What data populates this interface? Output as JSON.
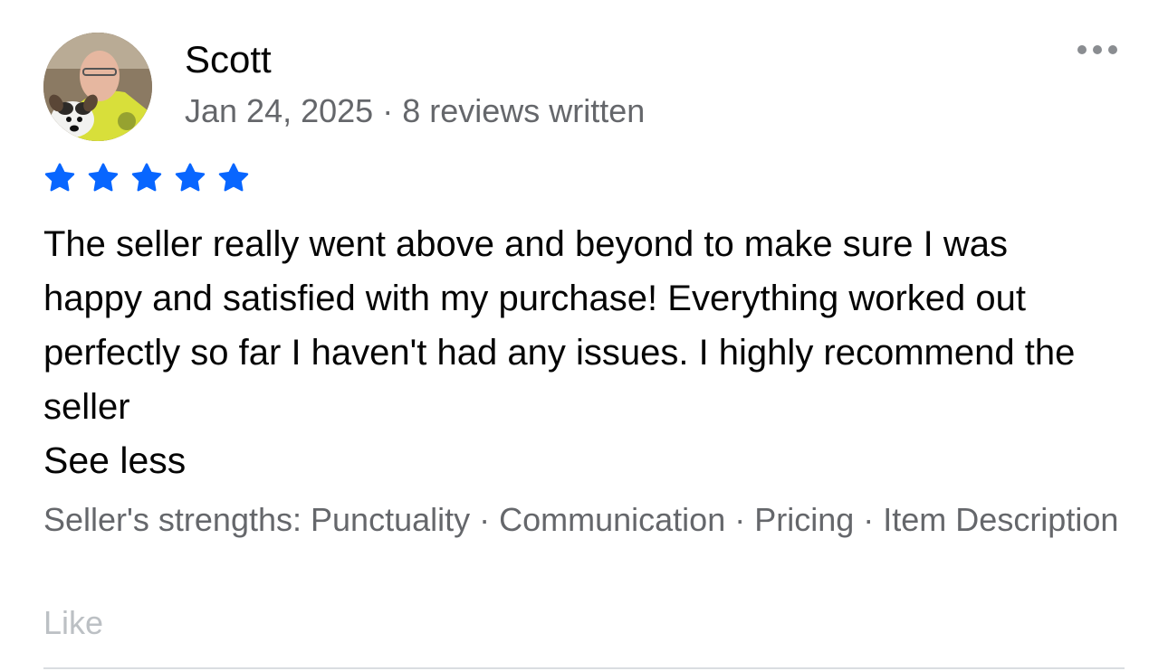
{
  "review": {
    "author": "Scott",
    "date": "Jan 24, 2025",
    "separator": "·",
    "review_count_text": "8 reviews written",
    "rating": 5,
    "rating_max": 5,
    "star_color": "#0866ff",
    "text": "The seller really went above and beyond to make sure I was happy and satisfied with my purchase! Everything worked out perfectly so far I haven't had any issues. I highly recommend the seller",
    "see_less_label": "See less",
    "strengths_prefix": "Seller's strengths:",
    "strengths": [
      "Punctuality",
      "Communication",
      "Pricing",
      "Item Description"
    ],
    "like_label": "Like",
    "more_icon": "more-horizontal-icon",
    "avatar_icon": "user-avatar-photo"
  }
}
